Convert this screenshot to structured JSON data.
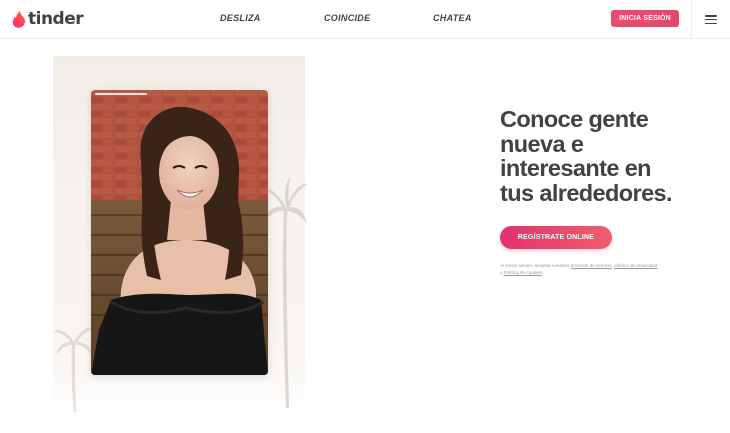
{
  "header": {
    "logo_text": "tinder",
    "nav": {
      "desliza": "DESLIZA",
      "coincide": "COINCIDE",
      "chatea": "CHATEA"
    },
    "login_label": "INICIA SESIÓN"
  },
  "hero": {
    "headline_lines": [
      "Conoce gente",
      "nueva e",
      "interesante en",
      "tus alrededores."
    ],
    "signup_label": "REGÍSTRATE ONLINE",
    "legal": {
      "prefix": "Al iniciar sesión, aceptas nuestros",
      "terms": "términos de servicio",
      "comma": ",",
      "privacy": "política de privacidad",
      "and": "y",
      "cookies": "Política de cookies",
      "suffix": "."
    }
  },
  "colors": {
    "brand": "#fd267a",
    "button_gradient_start": "#e3316e",
    "button_gradient_end": "#ef5f6c",
    "text": "#424242"
  },
  "icons": {
    "logo": "flame-icon",
    "menu": "hamburger-menu-icon"
  }
}
